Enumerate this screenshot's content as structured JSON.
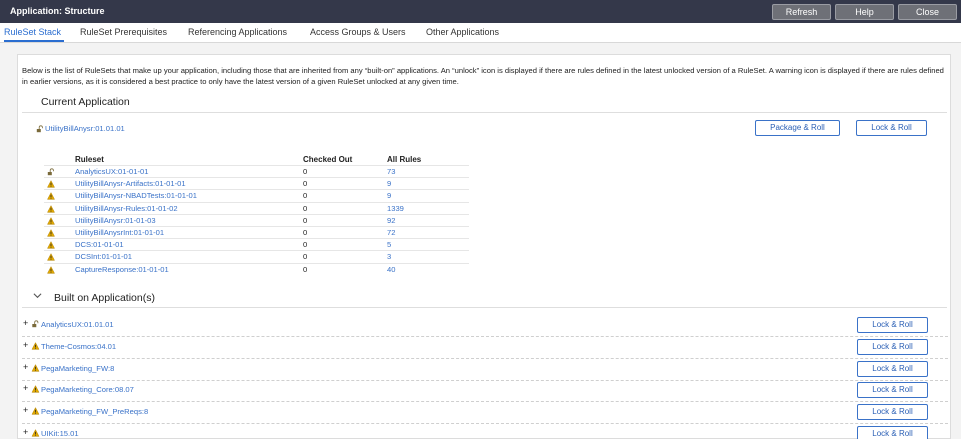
{
  "window": {
    "title": "Application: Structure",
    "buttons": {
      "refresh": "Refresh",
      "help": "Help",
      "close": "Close"
    }
  },
  "tabs": [
    "RuleSet Stack",
    "RuleSet Prerequisites",
    "Referencing Applications",
    "Access Groups & Users",
    "Other Applications"
  ],
  "intro": "Below is the list of RuleSets that make up your application, including those that are inherited from any “built-on” applications.  An “unlock” icon is displayed if there are rules defined in the latest unlocked version of a RuleSet.  A warning icon is displayed if there are rules defined in earlier versions, as it is considered a best practice to only have the latest version of a given RuleSet unlocked at any given time.",
  "current": {
    "heading": "Current Application",
    "app_link": "UtilityBillAnysr:01.01.01",
    "package_roll": "Package & Roll",
    "lock_roll": "Lock & Roll",
    "columns": {
      "ruleset": "Ruleset",
      "checked_out": "Checked Out",
      "all_rules": "All Rules"
    },
    "rows": [
      {
        "icon": "unlock-icon",
        "name": "AnalyticsUX:01-01-01",
        "checked_out": "0",
        "all_rules": "73"
      },
      {
        "icon": "warning-icon",
        "name": "UtilityBillAnysr-Artifacts:01-01-01",
        "checked_out": "0",
        "all_rules": "9"
      },
      {
        "icon": "warning-icon",
        "name": "UtilityBillAnysr-NBADTests:01-01-01",
        "checked_out": "0",
        "all_rules": "9"
      },
      {
        "icon": "warning-icon",
        "name": "UtilityBillAnysr-Rules:01-01-02",
        "checked_out": "0",
        "all_rules": "1339"
      },
      {
        "icon": "warning-icon",
        "name": "UtilityBillAnysr:01-01-03",
        "checked_out": "0",
        "all_rules": "92"
      },
      {
        "icon": "warning-icon",
        "name": "UtilityBillAnysrInt:01-01-01",
        "checked_out": "0",
        "all_rules": "72"
      },
      {
        "icon": "warning-icon",
        "name": "DCS:01-01-01",
        "checked_out": "0",
        "all_rules": "5"
      },
      {
        "icon": "warning-icon",
        "name": "DCSInt:01-01-01",
        "checked_out": "0",
        "all_rules": "3"
      },
      {
        "icon": "warning-icon",
        "name": "CaptureResponse:01-01-01",
        "checked_out": "0",
        "all_rules": "40"
      }
    ]
  },
  "built_on": {
    "heading": "Built on Application(s)",
    "lock_roll": "Lock & Roll",
    "apps": [
      {
        "icon": "unlock-icon",
        "name": "AnalyticsUX:01.01.01"
      },
      {
        "icon": "warning-icon",
        "name": "Theme-Cosmos:04.01"
      },
      {
        "icon": "warning-icon",
        "name": "PegaMarketing_FW:8"
      },
      {
        "icon": "warning-icon",
        "name": "PegaMarketing_Core:08.07"
      },
      {
        "icon": "warning-icon",
        "name": "PegaMarketing_FW_PreReqs:8"
      },
      {
        "icon": "warning-icon",
        "name": "UIKit:15.01"
      }
    ]
  },
  "colors": {
    "titlebar": "#34384a",
    "accent": "#2a6dd0",
    "warning": "#e0a800"
  }
}
